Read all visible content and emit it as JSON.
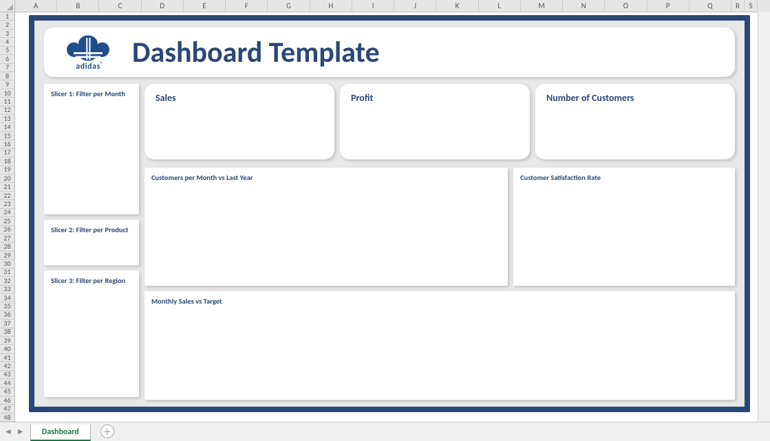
{
  "columns": [
    "A",
    "B",
    "C",
    "D",
    "E",
    "F",
    "G",
    "H",
    "I",
    "J",
    "K",
    "L",
    "M",
    "N",
    "O",
    "P",
    "Q",
    "R",
    "S"
  ],
  "rows": [
    "1",
    "2",
    "3",
    "4",
    "5",
    "6",
    "7",
    "8",
    "9",
    "10",
    "11",
    "12",
    "13",
    "14",
    "15",
    "16",
    "17",
    "18",
    "19",
    "20",
    "21",
    "22",
    "23",
    "24",
    "25",
    "26",
    "27",
    "28",
    "29",
    "30",
    "31",
    "32",
    "33",
    "34",
    "35",
    "36",
    "37",
    "38",
    "39",
    "40",
    "41",
    "42",
    "43",
    "44",
    "45",
    "46",
    "47",
    "48"
  ],
  "tab": {
    "active": "Dashboard"
  },
  "nav": {
    "prev": "◄",
    "next": "►"
  },
  "brand": {
    "name": "adidas",
    "reg": "®"
  },
  "header": {
    "title": "Dashboard Template"
  },
  "slicers": {
    "s1": "Slicer 1: Filter per Month",
    "s2": "Slicer 2: Filter per Product",
    "s3": "Slicer 3: Filter per Region"
  },
  "kpi": {
    "sales": "Sales",
    "profit": "Profit",
    "customers": "Number of Customers"
  },
  "mid": {
    "left": "Customers per Month vs Last Year",
    "right": "Customer Satisfaction Rate"
  },
  "bottom": {
    "title": "Monthly Sales vs Target"
  }
}
